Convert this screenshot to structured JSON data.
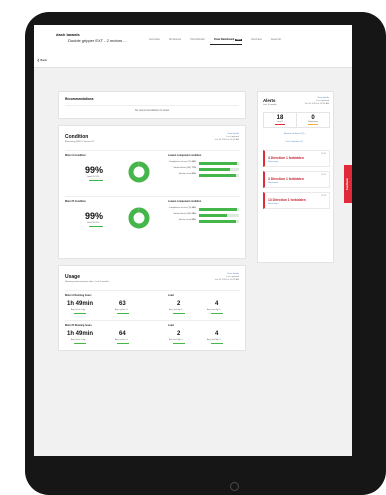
{
  "header": {
    "logo": "dash boards",
    "subtitle": "STOP",
    "title": "Double gripper EXT - 2 motors ...",
    "tabs": [
      {
        "label": "Overview",
        "active": false
      },
      {
        "label": "All devices",
        "active": false
      },
      {
        "label": "Flow Monitor",
        "active": false
      },
      {
        "label": "Flow Dashboard",
        "active": true,
        "badge": "NEW"
      },
      {
        "label": "Overview",
        "active": false
      },
      {
        "label": "Issue list",
        "active": false
      }
    ],
    "back_label": "Back"
  },
  "recommendations": {
    "title": "Recommendations",
    "empty_text": "No recommendations to show"
  },
  "condition": {
    "title": "Condition",
    "subtitle": "Remaining 499% / Service 26",
    "right_link": "View details",
    "right_line1": "Last updated",
    "right_line2": "Jun 26 2024 at 10:23 AM",
    "component_header": "Lowest component condition",
    "motors": [
      {
        "label": "Motor A Condition",
        "percent": "99%",
        "percent_value": 0.99,
        "sub": "Good 99.99%",
        "components": [
          {
            "label": "Compliance at rest (%)",
            "pct": "96%",
            "fill": 0.96
          },
          {
            "label": "Stroke Ratio (L/R)",
            "pct": "77%",
            "fill": 0.77
          },
          {
            "label": "Stroke count",
            "pct": "93%",
            "fill": 0.93
          }
        ]
      },
      {
        "label": "Motor B Condition",
        "percent": "99%",
        "percent_value": 0.99,
        "sub": "Good 99.99%",
        "components": [
          {
            "label": "Compliance at rest (%)",
            "pct": "96%",
            "fill": 0.96
          },
          {
            "label": "Stroke Ratio (L/R)",
            "pct": "69%",
            "fill": 0.69
          },
          {
            "label": "Stroke count",
            "pct": "93%",
            "fill": 0.93
          }
        ]
      }
    ]
  },
  "usage": {
    "title": "Usage",
    "subtitle": "Showing measurements data · Last 3 months",
    "right_link": "View details",
    "right_line1": "Last updated",
    "right_line2": "Jun 26 2024 at 10:23 AM",
    "load_header": "Load",
    "motors": [
      {
        "label": "Motor A Running hours",
        "time": "1h 49min",
        "time_sub": "Avg. hours / day",
        "cycles": "63",
        "cycles_sub": "Avg. cycles / h",
        "load_a": "2",
        "load_a_sub": "Avg. load kg / h",
        "load_b": "4",
        "load_b_sub": "Avg. load kg / h"
      },
      {
        "label": "Motor B Running hours",
        "time": "1h 49min",
        "time_sub": "Avg. hours / day",
        "cycles": "64",
        "cycles_sub": "Avg. cycles / h",
        "load_a": "2",
        "load_a_sub": "Avg. load kg / h",
        "load_b": "4",
        "load_b_sub": "Avg. load kg / h"
      }
    ]
  },
  "alerts": {
    "title": "Alerts",
    "subtitle": "Last 3 months",
    "right_link": "View details",
    "right_line1": "Last updated",
    "right_line2": "Jun 26 2024 at 10:23 AM",
    "counts": [
      {
        "value": "18",
        "label": "Level 1",
        "color": "#e02a3a"
      },
      {
        "value": "0",
        "label": "Predictions",
        "color": "#f2b233"
      }
    ],
    "link_actions": "Review all alerts (13) →",
    "link_history": "Last 3 months (2) →",
    "items": [
      {
        "name": "4 Direction 1 forbidden",
        "link": "Show more",
        "time": "10:23"
      },
      {
        "name": "3 Direction 1 forbidden",
        "link": "Show more",
        "time": "10:21"
      },
      {
        "name": "13 Direction 1 forbidden",
        "link": "Show more",
        "time": "10:18"
      }
    ]
  },
  "feedback": {
    "label": "Feedback"
  },
  "colors": {
    "accent_green": "#45b649",
    "alert_red": "#e02a3a",
    "link_blue": "#4a7fc7"
  }
}
